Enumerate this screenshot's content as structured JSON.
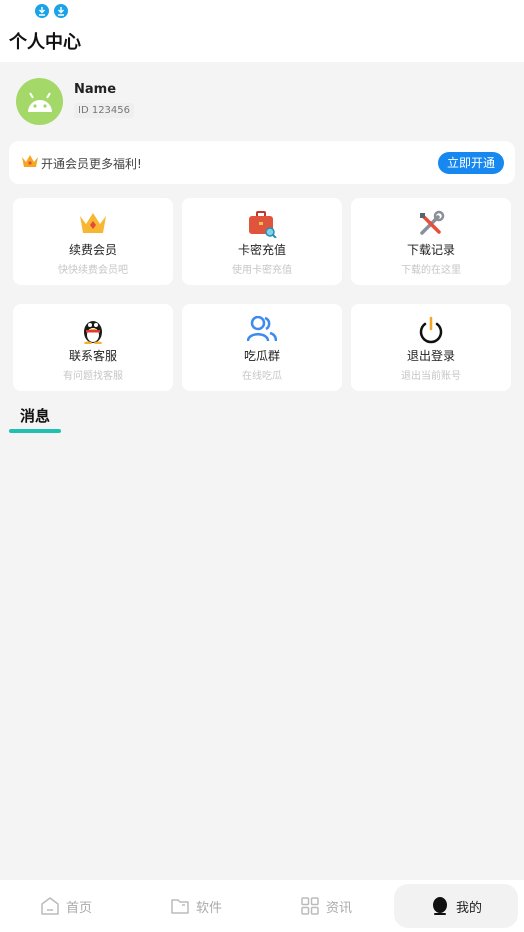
{
  "header": {
    "title": "个人中心",
    "status_icons": [
      "download-icon",
      "download-icon"
    ]
  },
  "profile": {
    "name": "Name",
    "id_text": "ID 123456",
    "avatar_icon": "android-icon"
  },
  "vip_banner": {
    "icon": "crown-icon",
    "text": "开通会员更多福利!",
    "button_label": "立即开通"
  },
  "features": [
    {
      "title": "续费会员",
      "subtitle": "快快续费会员吧",
      "icon": "crown-icon"
    },
    {
      "title": "卡密充值",
      "subtitle": "使用卡密充值",
      "icon": "briefcase-icon"
    },
    {
      "title": "下载记录",
      "subtitle": "下载的在这里",
      "icon": "tools-icon"
    },
    {
      "title": "联系客服",
      "subtitle": "有问题找客服",
      "icon": "penguin-icon"
    },
    {
      "title": "吃瓜群",
      "subtitle": "在线吃瓜",
      "icon": "group-icon"
    },
    {
      "title": "退出登录",
      "subtitle": "退出当前账号",
      "icon": "power-icon"
    }
  ],
  "section": {
    "title": "消息"
  },
  "tabs": [
    {
      "label": "首页",
      "icon": "home-icon",
      "active": false
    },
    {
      "label": "软件",
      "icon": "folder-icon",
      "active": false
    },
    {
      "label": "资讯",
      "icon": "grid-icon",
      "active": false
    },
    {
      "label": "我的",
      "icon": "user-icon",
      "active": true
    }
  ],
  "colors": {
    "accent": "#1688f0",
    "underline": "#1ec1b0",
    "background": "#f4f4f4",
    "avatar": "#a4d868"
  }
}
